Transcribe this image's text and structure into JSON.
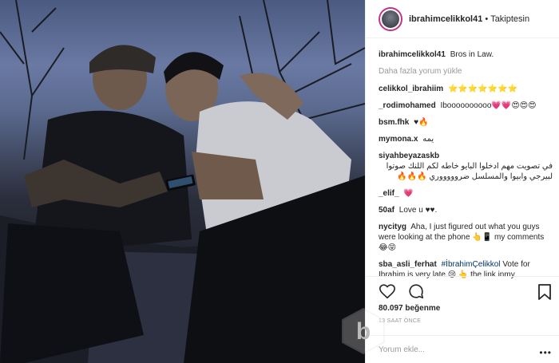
{
  "post": {
    "username": "ibrahimcelikkol41",
    "separator": "•",
    "follow_status": "Takiptesin",
    "caption_user": "ibrahimcelikkol41",
    "caption_text": "Bros in Law.",
    "load_more": "Daha fazla yorum yükle"
  },
  "comments": [
    {
      "user": "celikkol_ibrahiim",
      "text": "⭐⭐⭐⭐⭐⭐⭐"
    },
    {
      "user": "_rodimohamed",
      "text": "Iboooooooooo💗💗😍😍😍"
    },
    {
      "user": "bsm.fhk",
      "text": "♥🔥"
    },
    {
      "user": "mymona.x",
      "text": "يمه"
    },
    {
      "user": "siyahbeyazaskb",
      "text": "في تصويت مهم ادخلوا البايو خاطه لكم اللنك صوتوا لبيرجي وابيوا والمسلسل ضروووووري 🔥🔥🔥"
    },
    {
      "user": "_elif_",
      "text": "💗"
    },
    {
      "user": "50af",
      "text": "Love u ♥♥."
    },
    {
      "user": "nycityg",
      "text": "Aha, I just figured out what you guys were looking at the phone 👆📱 my comments 😂😝"
    },
    {
      "user": "sba_asli_ferhat",
      "tag": "#İbrahimÇelikkol",
      "text": "Vote for Ibrahim is very late 😢 👆 the link inmy"
    }
  ],
  "likes": "80.097 beğenme",
  "timestamp": "13 SAAT ÖNCE",
  "add_comment_placeholder": "Yorum ekle...",
  "more_label": "•••",
  "watermark_letter": "b",
  "colors": {
    "link": "#003569",
    "muted": "#999999",
    "border": "#efefef",
    "avatar_ring": "#c13584"
  },
  "icons": {
    "like": "heart-icon",
    "comment": "comment-icon",
    "save": "bookmark-icon",
    "more": "more-options-icon"
  }
}
